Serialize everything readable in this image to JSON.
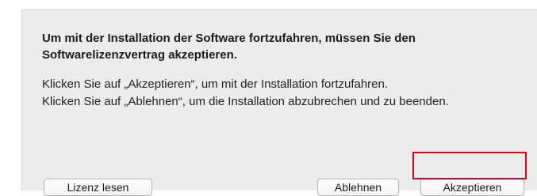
{
  "dialog": {
    "heading": "Um mit der Installation der Software fortzufahren, müssen Sie den Softwarelizenzvertrag akzeptieren.",
    "body_line_1": "Klicken Sie auf „Akzeptieren“, um mit der Installation fortzufahren.",
    "body_line_2": "Klicken Sie auf „Ablehnen“, um die Installation abzubrechen und zu beenden."
  },
  "buttons": {
    "read_license": "Lizenz lesen",
    "decline": "Ablehnen",
    "accept": "Akzeptieren"
  },
  "colors": {
    "dialog_background": "#ececec",
    "highlight_border": "#d0021b"
  }
}
